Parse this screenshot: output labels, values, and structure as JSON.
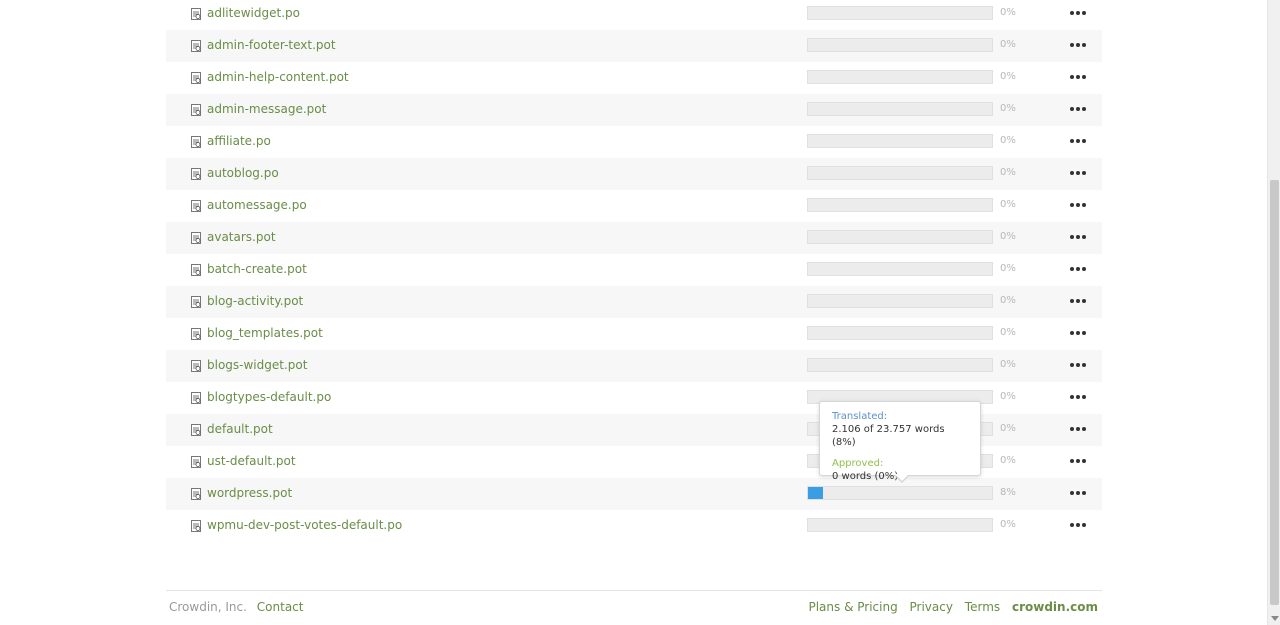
{
  "files": [
    {
      "name": "adlitewidget.po",
      "percent": "0%",
      "progress": 0
    },
    {
      "name": "admin-footer-text.pot",
      "percent": "0%",
      "progress": 0
    },
    {
      "name": "admin-help-content.pot",
      "percent": "0%",
      "progress": 0
    },
    {
      "name": "admin-message.pot",
      "percent": "0%",
      "progress": 0
    },
    {
      "name": "affiliate.po",
      "percent": "0%",
      "progress": 0
    },
    {
      "name": "autoblog.po",
      "percent": "0%",
      "progress": 0
    },
    {
      "name": "automessage.po",
      "percent": "0%",
      "progress": 0
    },
    {
      "name": "avatars.pot",
      "percent": "0%",
      "progress": 0
    },
    {
      "name": "batch-create.pot",
      "percent": "0%",
      "progress": 0
    },
    {
      "name": "blog-activity.pot",
      "percent": "0%",
      "progress": 0
    },
    {
      "name": "blog_templates.pot",
      "percent": "0%",
      "progress": 0
    },
    {
      "name": "blogs-widget.pot",
      "percent": "0%",
      "progress": 0
    },
    {
      "name": "blogtypes-default.po",
      "percent": "0%",
      "progress": 0
    },
    {
      "name": "default.pot",
      "percent": "0%",
      "progress": 0
    },
    {
      "name": "ust-default.pot",
      "percent": "0%",
      "progress": 0
    },
    {
      "name": "wordpress.pot",
      "percent": "8%",
      "progress": 8
    },
    {
      "name": "wpmu-dev-post-votes-default.po",
      "percent": "0%",
      "progress": 0
    }
  ],
  "tooltip": {
    "translated_label": "Translated:",
    "translated_value": "2.106 of 23.757 words (8%)",
    "approved_label": "Approved:",
    "approved_value": "0 words (0%)"
  },
  "footer": {
    "company": "Crowdin, Inc.",
    "contact": "Contact",
    "plans": "Plans & Pricing",
    "privacy": "Privacy",
    "terms": "Terms",
    "brand": "crowdin.com"
  },
  "colors": {
    "link": "#6a8d47",
    "progress_fill": "#3a9ee4",
    "progress_bg": "#ececec"
  },
  "icons": {
    "file": "file-type-icon",
    "menu": "more-horizontal-icon"
  }
}
